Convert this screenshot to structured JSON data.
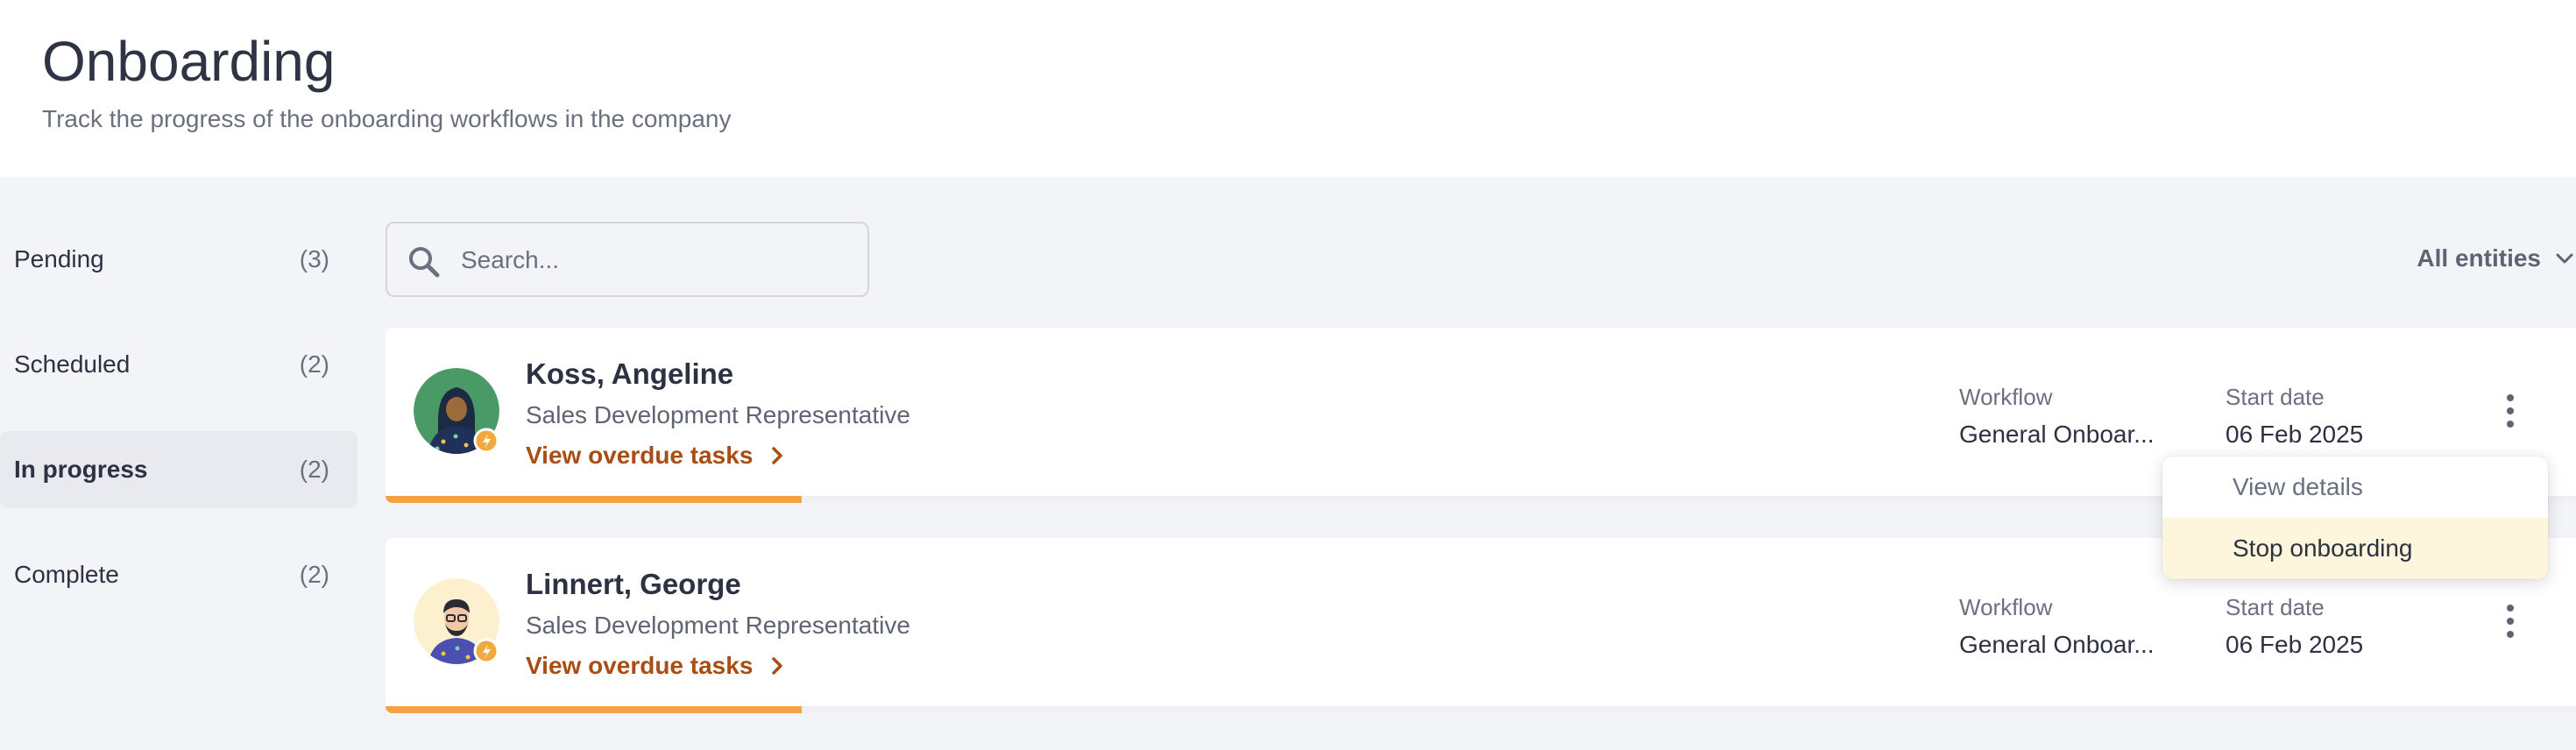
{
  "header": {
    "title": "Onboarding",
    "subtitle": "Track the progress of the onboarding workflows in the company"
  },
  "sidebar": {
    "items": [
      {
        "label": "Pending",
        "count": "(3)",
        "active": false
      },
      {
        "label": "Scheduled",
        "count": "(2)",
        "active": false
      },
      {
        "label": "In progress",
        "count": "(2)",
        "active": true
      },
      {
        "label": "Complete",
        "count": "(2)",
        "active": false
      }
    ]
  },
  "search": {
    "placeholder": "Search...",
    "value": ""
  },
  "filter": {
    "label": "All entities",
    "icon": "chevron-down-icon"
  },
  "labels": {
    "workflow": "Workflow",
    "start_date": "Start date"
  },
  "employees": [
    {
      "name": "Koss, Angeline",
      "role": "Sales Development Representative",
      "link": "View overdue tasks",
      "workflow": "General Onboar...",
      "start_date": "06 Feb 2025",
      "progress": 0.19,
      "avatar_bg": "#4a9a68"
    },
    {
      "name": "Linnert, George",
      "role": "Sales Development Representative",
      "link": "View overdue tasks",
      "workflow": "General Onboar...",
      "start_date": "06 Feb 2025",
      "progress": 0.19,
      "avatar_bg": "#fdf0cf"
    }
  ],
  "menu": {
    "items": [
      {
        "label": "View details"
      },
      {
        "label": "Stop onboarding",
        "highlighted": true
      }
    ]
  },
  "colors": {
    "accent": "#a84e14",
    "progress": "#f4a340",
    "badge": "#f2a93b"
  }
}
